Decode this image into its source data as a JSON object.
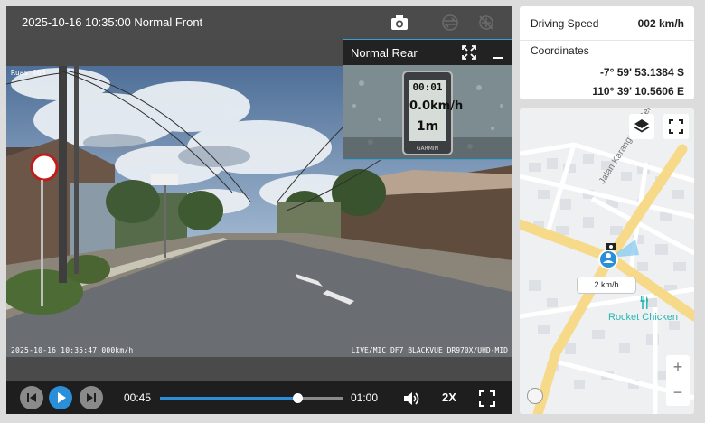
{
  "player": {
    "title": "2025-10-16 10:35:00 Normal Front",
    "osd_top_left": "Ruas 003",
    "osd_bottom_left": "2025-10-16 10:35:47 000km/h",
    "osd_bottom_right": "LIVE/MIC DF7 BLACKVUE DR970X/UHD-MID"
  },
  "pip": {
    "title": "Normal Rear",
    "gauge_line1": "00:01",
    "gauge_line2": "0.0km/h",
    "gauge_line3": "1m",
    "gauge_brand": "GARMIN"
  },
  "controls": {
    "current_time": "00:45",
    "total_time": "01:00",
    "progress": 0.75,
    "speed_label": "2X"
  },
  "info": {
    "speed_label": "Driving Speed",
    "speed_value": "002 km/h",
    "coord_label": "Coordinates",
    "latitude": "-7° 59' 53.1384 S",
    "longitude": "110° 39' 10.5606 E"
  },
  "map": {
    "street_label": "Jalan Karangmojo-Ser",
    "poi_label": "Rocket Chicken",
    "vehicle_speed": "2 km/h",
    "zoom_in": "+",
    "zoom_out": "−"
  },
  "colors": {
    "accent": "#2a8fd8",
    "poi": "#2bb7b3",
    "road_major": "#f7d98a"
  }
}
